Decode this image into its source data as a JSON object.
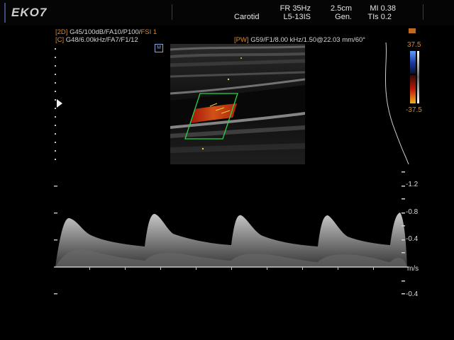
{
  "brand": {
    "logo": "EKO7"
  },
  "header": {
    "preset": "Carotid",
    "frame_rate": "FR 35Hz",
    "probe": "L5-13IS",
    "depth": "2.5cm",
    "mode": "Gen.",
    "mi": "MI 0.38",
    "tis": "TIs 0.2"
  },
  "params": {
    "b_mode_tag": "[2D]",
    "b_mode_values": "G45/100dB/FA10/P100/",
    "fsi": "FSI 1",
    "color_tag": "[C]",
    "color_values": "G48/6.00kHz/FA7/F1/12",
    "pw_tag": "[PW]",
    "pw_values": "G59/F1/8.00 kHz/1.50@22.03 mm/60°"
  },
  "markers": {
    "m_box": "M"
  },
  "color_bar": {
    "top": "37.5",
    "bottom": "-37.5",
    "top_color": "#2a6bd8",
    "bottom_color": "#e8a020"
  },
  "velocity_scale": {
    "labels": [
      "-1.2",
      "-0.8",
      "-0.4",
      "m/s",
      "-0.4"
    ],
    "unit": "m/s"
  },
  "colors": {
    "orange": "#d98a2c",
    "sample_box": "#2bd14a"
  }
}
